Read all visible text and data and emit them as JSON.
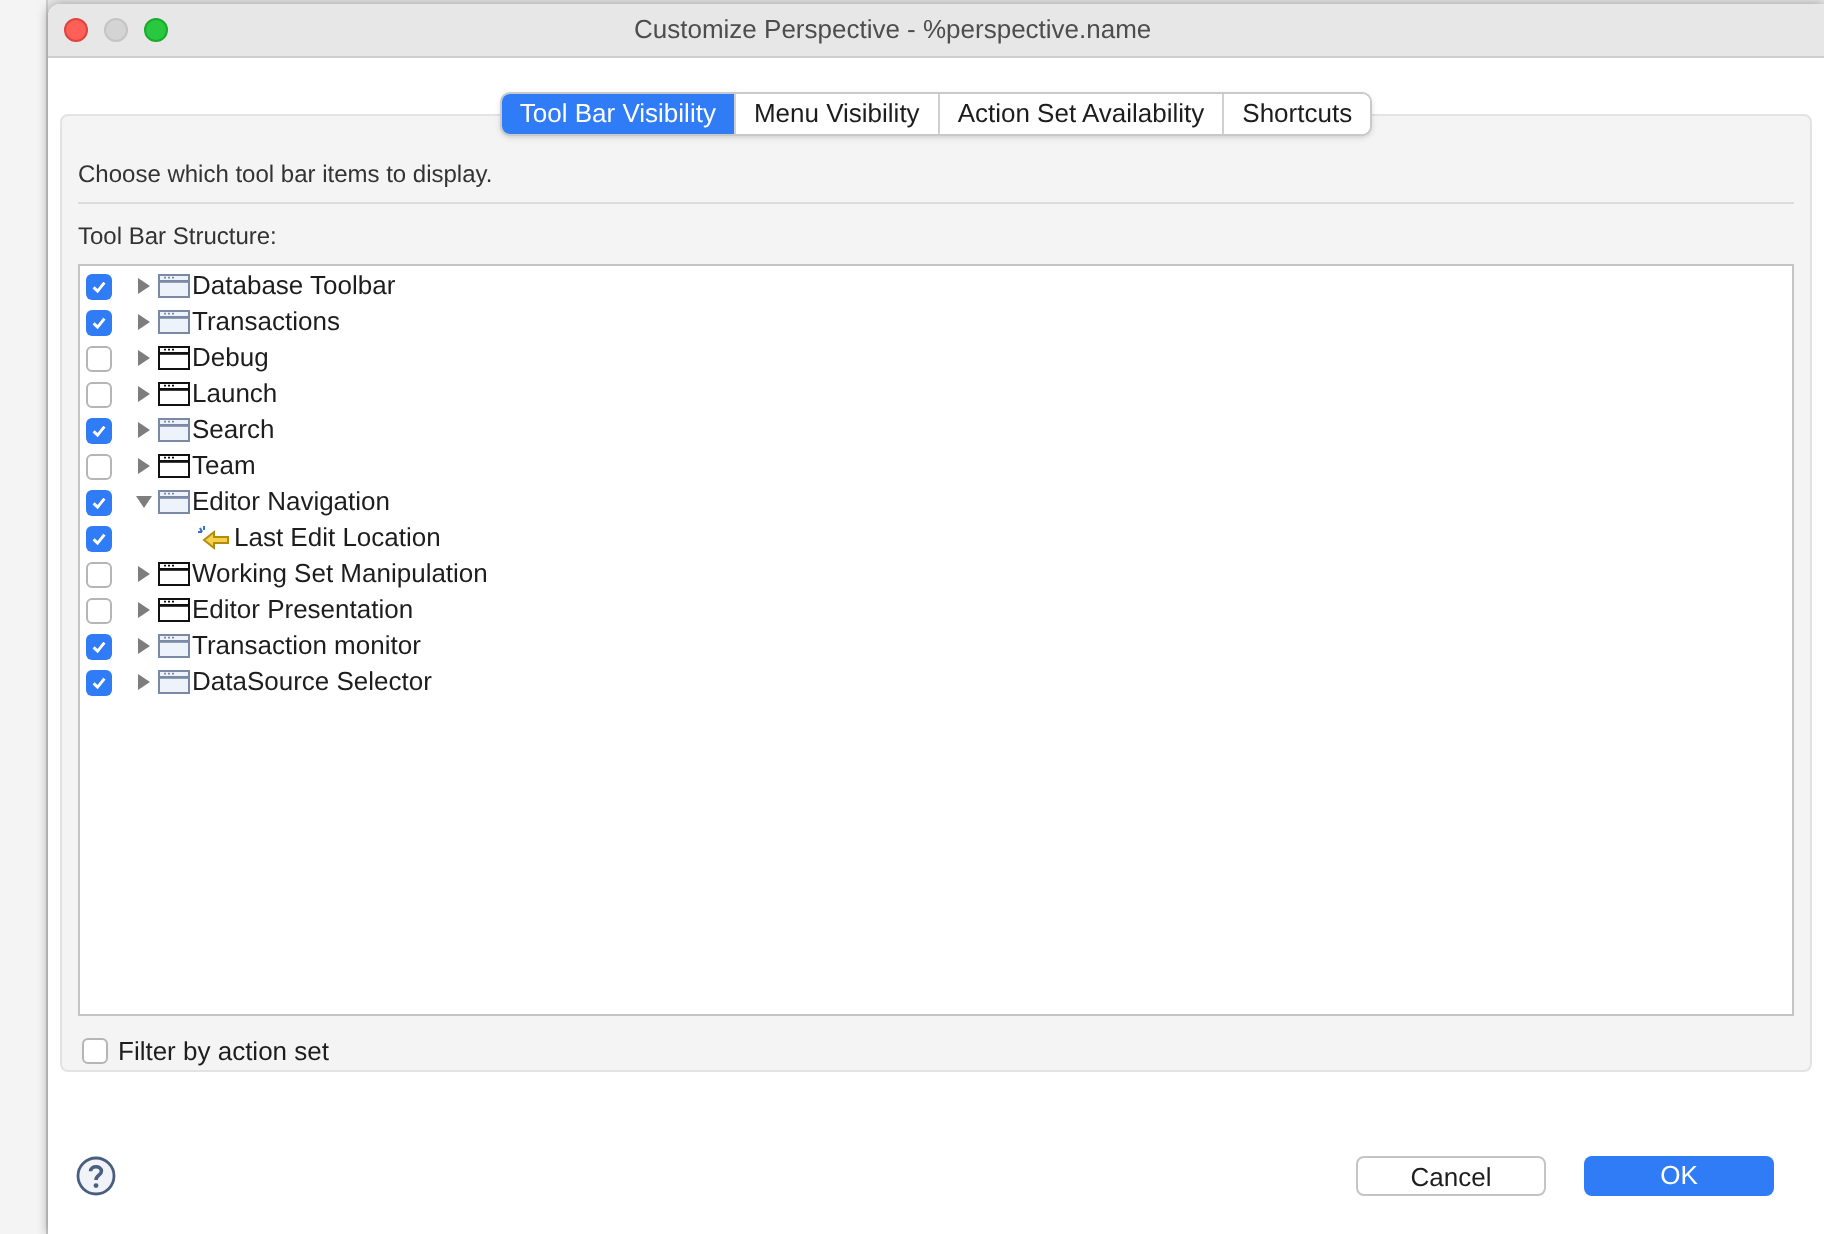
{
  "window": {
    "title": "Customize Perspective - %perspective.name"
  },
  "tabs": [
    {
      "label": "Tool Bar Visibility",
      "selected": true
    },
    {
      "label": "Menu Visibility",
      "selected": false
    },
    {
      "label": "Action Set Availability",
      "selected": false
    },
    {
      "label": "Shortcuts",
      "selected": false
    }
  ],
  "description": "Choose which tool bar items to display.",
  "tree": {
    "label": "Tool Bar Structure:",
    "items": [
      {
        "label": "Database Toolbar",
        "checked": true,
        "expanded": false,
        "kind": "toolbar"
      },
      {
        "label": "Transactions",
        "checked": true,
        "expanded": false,
        "kind": "toolbar"
      },
      {
        "label": "Debug",
        "checked": false,
        "expanded": false,
        "kind": "toolbar"
      },
      {
        "label": "Launch",
        "checked": false,
        "expanded": false,
        "kind": "toolbar"
      },
      {
        "label": "Search",
        "checked": true,
        "expanded": false,
        "kind": "toolbar"
      },
      {
        "label": "Team",
        "checked": false,
        "expanded": false,
        "kind": "toolbar"
      },
      {
        "label": "Editor Navigation",
        "checked": true,
        "expanded": true,
        "kind": "toolbar",
        "children": [
          {
            "label": "Last Edit Location",
            "checked": true,
            "kind": "action"
          }
        ]
      },
      {
        "label": "Working Set Manipulation",
        "checked": false,
        "expanded": false,
        "kind": "toolbar"
      },
      {
        "label": "Editor Presentation",
        "checked": false,
        "expanded": false,
        "kind": "toolbar"
      },
      {
        "label": "Transaction monitor",
        "checked": true,
        "expanded": false,
        "kind": "toolbar"
      },
      {
        "label": "DataSource Selector",
        "checked": true,
        "expanded": false,
        "kind": "toolbar"
      }
    ]
  },
  "filter": {
    "label": "Filter by action set",
    "checked": false
  },
  "buttons": [
    {
      "label": "Cancel",
      "kind": "secondary"
    },
    {
      "label": "OK",
      "kind": "primary"
    }
  ]
}
